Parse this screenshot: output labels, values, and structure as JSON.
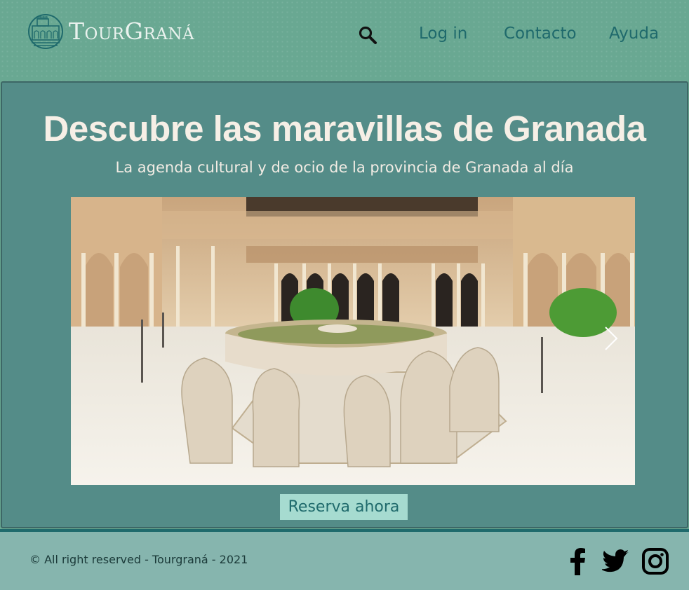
{
  "header": {
    "brand": "TourGraná",
    "logo_icon": "alhambra-logo-icon",
    "search_icon": "search-icon",
    "nav": [
      {
        "label": "Log in"
      },
      {
        "label": "Contacto"
      },
      {
        "label": "Ayuda"
      }
    ]
  },
  "hero": {
    "title": "Descubre las maravillas de Granada",
    "subtitle": "La agenda cultural y de ocio de la provincia de Granada al día",
    "slide_icon": "chevron-right-icon",
    "cta_label": "Reserva ahora"
  },
  "footer": {
    "copyright": "© All right reserved - Tourgraná - 2021",
    "social": [
      {
        "icon": "facebook-icon"
      },
      {
        "icon": "twitter-icon"
      },
      {
        "icon": "instagram-icon"
      }
    ]
  },
  "colors": {
    "header_bg": "#69a892",
    "hero_bg": "#548c88",
    "accent_teal": "#1f6a6c",
    "cta_bg": "#a6dbd0",
    "footer_bg": "#86b5ae"
  }
}
